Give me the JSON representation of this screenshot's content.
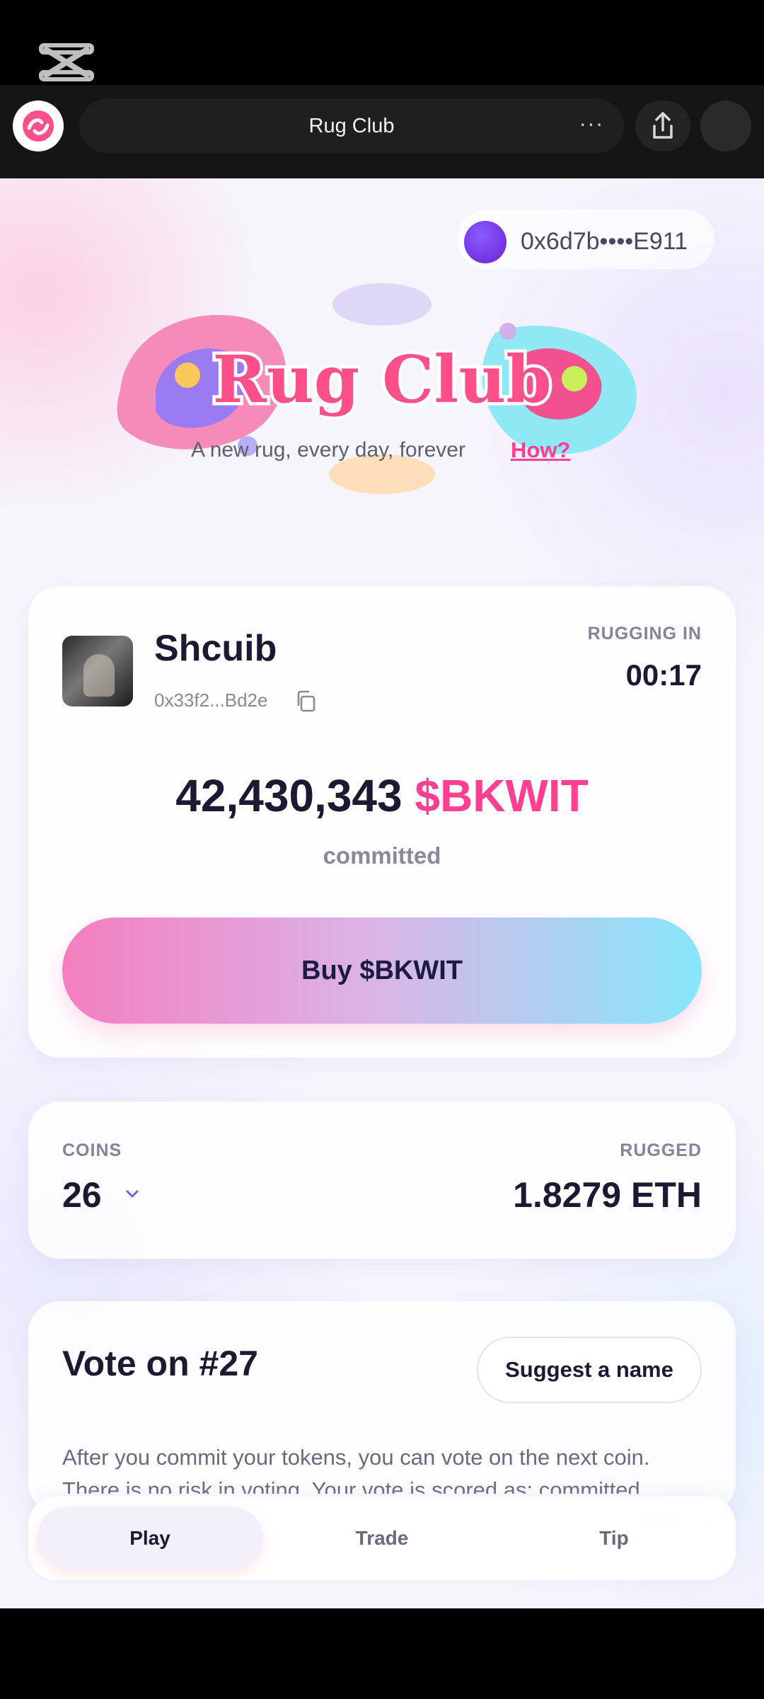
{
  "browser": {
    "title": "Rug Club",
    "menu_glyph": "···"
  },
  "wallet": {
    "address": "0x6d7b••••E911"
  },
  "hero": {
    "logo_text": "Rug Club",
    "tagline": "A new rug, every day, forever",
    "how_link": "How?"
  },
  "token": {
    "name": "Shcuib",
    "address": "0x33f2...Bd2e",
    "rugging_label": "RUGGING IN",
    "timer": "00:17",
    "committed_amount": "42,430,343",
    "ticker": "$BKWIT",
    "committed_label": "committed",
    "buy_label": "Buy $BKWIT"
  },
  "stats": {
    "coins_label": "COINS",
    "coins_value": "26",
    "rugged_label": "RUGGED",
    "rugged_value": "1.8279 ETH"
  },
  "vote": {
    "title": "Vote on #27",
    "suggest_label": "Suggest a name",
    "description": "After you commit your tokens, you can vote on the next coin. There is no risk in voting. Your vote is scored as: committed"
  },
  "tabs": [
    {
      "label": "Play",
      "active": true
    },
    {
      "label": "Trade",
      "active": false
    },
    {
      "label": "Tip",
      "active": false
    }
  ],
  "icons": {
    "capcut": "capcut-icon",
    "favicon": "rug-club-favicon-icon",
    "share": "share-icon",
    "copy": "copy-icon",
    "chevron": "chevron-down-icon"
  },
  "colors": {
    "accent_pink": "#ff3f92",
    "button_gradient_start": "#f47ebf",
    "button_gradient_end": "#87e6fb",
    "wallet_dot": "#7b3cf0",
    "text_dark": "#1c1a33"
  }
}
